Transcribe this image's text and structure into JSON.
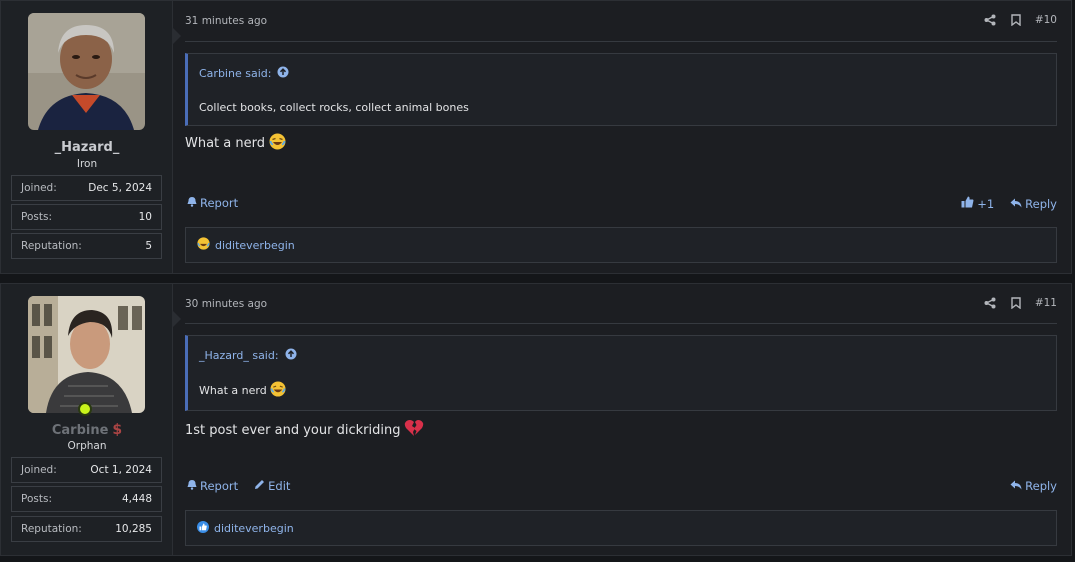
{
  "posts": [
    {
      "user": {
        "name": "_Hazard_",
        "title": "Iron",
        "avatar": "avatar-hazard",
        "stats": [
          {
            "label": "Joined:",
            "value": "Dec 5, 2024"
          },
          {
            "label": "Posts:",
            "value": "10"
          },
          {
            "label": "Reputation:",
            "value": "5"
          }
        ]
      },
      "time": "31 minutes ago",
      "post_number": "#10",
      "quote": {
        "author": "Carbine said:",
        "body": "Collect books, collect rocks, collect animal bones"
      },
      "message": "What a nerd",
      "actions_left": [
        "Report"
      ],
      "like_count": "+1",
      "reply_label": "Reply",
      "reaction_user": "diditeverbegin",
      "reaction_icon": "laughing-face-icon"
    },
    {
      "user": {
        "name": "Carbine",
        "title": "Orphan",
        "avatar": "avatar-carbine",
        "online": true,
        "stats": [
          {
            "label": "Joined:",
            "value": "Oct 1, 2024"
          },
          {
            "label": "Posts:",
            "value": "4,448"
          },
          {
            "label": "Reputation:",
            "value": "10,285"
          }
        ]
      },
      "time": "30 minutes ago",
      "post_number": "#11",
      "quote": {
        "author": "_Hazard_ said:",
        "body": "What a nerd"
      },
      "message": "1st post ever and your dickriding",
      "actions_left": [
        "Report",
        "Edit"
      ],
      "reply_label": "Reply",
      "reaction_user": "diditeverbegin",
      "reaction_icon": "thumbs-up-icon"
    }
  ],
  "colors": {
    "link": "#8fb4ea",
    "quote_border": "#4a6db8",
    "online": "#c9f51b",
    "background": "#1c1e22"
  }
}
